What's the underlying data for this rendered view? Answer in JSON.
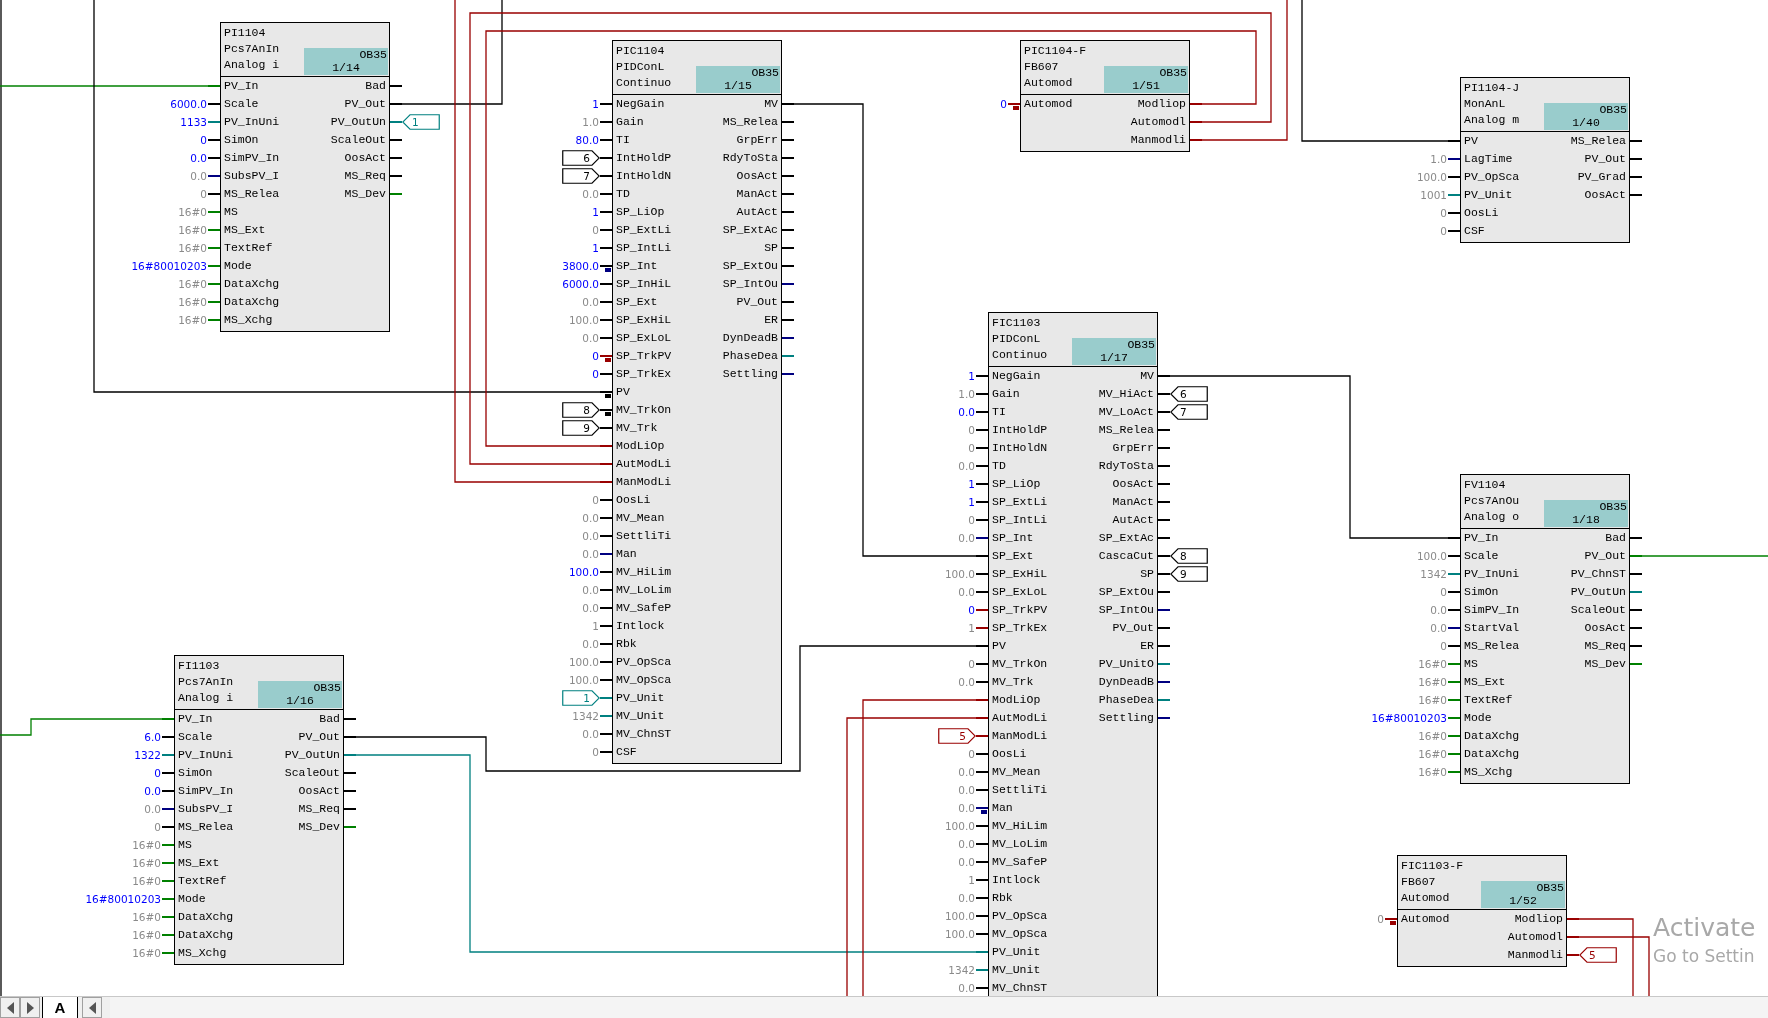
{
  "blocks": [
    {
      "name": "PI1104",
      "type": "Pcs7AnIn",
      "comment": "Analog i",
      "task": "OB35",
      "order": "1/14",
      "inputs": [
        {
          "pin": "PV_In",
          "kind": "wire",
          "color": "#008000"
        },
        {
          "pin": "Scale",
          "kind": "value",
          "value": "6000.0",
          "user_set": true
        },
        {
          "pin": "PV_InUni",
          "kind": "value",
          "value": "1133",
          "user_set": true,
          "color": "#008080"
        },
        {
          "pin": "SimOn",
          "kind": "value",
          "value": "0",
          "user_set": true
        },
        {
          "pin": "SimPV_In",
          "kind": "value",
          "value": "0.0",
          "user_set": true
        },
        {
          "pin": "SubsPV_I",
          "kind": "value",
          "value": "0.0",
          "user_set": false,
          "color": "#000080"
        },
        {
          "pin": "MS_Relea",
          "kind": "value",
          "value": "0",
          "user_set": false
        },
        {
          "pin": "MS",
          "kind": "value",
          "value": "16#0",
          "user_set": false,
          "color": "#008000"
        },
        {
          "pin": "MS_Ext",
          "kind": "value",
          "value": "16#0",
          "user_set": false,
          "color": "#008000"
        },
        {
          "pin": "TextRef",
          "kind": "value",
          "value": "16#0",
          "user_set": false,
          "color": "#008000"
        },
        {
          "pin": "Mode",
          "kind": "value",
          "value": "16#80010203",
          "user_set": true,
          "color": "#008000"
        },
        {
          "pin": "DataXchg",
          "kind": "value",
          "value": "16#0",
          "user_set": false,
          "color": "#008000"
        },
        {
          "pin": "DataXchg",
          "kind": "value",
          "value": "16#0",
          "user_set": false,
          "color": "#008000"
        },
        {
          "pin": "MS_Xchg",
          "kind": "value",
          "value": "16#0",
          "user_set": false,
          "color": "#008000"
        }
      ],
      "outputs": [
        {
          "pin": "Bad",
          "kind": "stub"
        },
        {
          "pin": "PV_Out",
          "kind": "stub"
        },
        {
          "pin": "PV_OutUn",
          "kind": "connector",
          "value": "1",
          "color": "#008080"
        },
        {
          "pin": "ScaleOut",
          "kind": "stub"
        },
        {
          "pin": "OosAct",
          "kind": "stub"
        },
        {
          "pin": "MS_Req",
          "kind": "stub"
        },
        {
          "pin": "MS_Dev",
          "kind": "stub",
          "color": "#008000"
        }
      ]
    },
    {
      "name": "PIC1104",
      "type": "PIDConL",
      "comment": "Continuo",
      "task": "OB35",
      "order": "1/15",
      "inputs": [
        {
          "pin": "NegGain",
          "kind": "value",
          "value": "1",
          "user_set": true
        },
        {
          "pin": "Gain",
          "kind": "value",
          "value": "1.0",
          "user_set": false
        },
        {
          "pin": "TI",
          "kind": "value",
          "value": "80.0",
          "user_set": true
        },
        {
          "pin": "IntHoldP",
          "kind": "connector",
          "value": "6"
        },
        {
          "pin": "IntHoldN",
          "kind": "connector",
          "value": "7"
        },
        {
          "pin": "TD",
          "kind": "value",
          "value": "0.0",
          "user_set": false
        },
        {
          "pin": "SP_LiOp",
          "kind": "value",
          "value": "1",
          "user_set": true
        },
        {
          "pin": "SP_ExtLi",
          "kind": "value",
          "value": "0",
          "user_set": false
        },
        {
          "pin": "SP_IntLi",
          "kind": "value",
          "value": "1",
          "user_set": true
        },
        {
          "pin": "SP_Int",
          "kind": "value",
          "value": "3800.0",
          "user_set": true,
          "marker": {
            "color": "#000080"
          }
        },
        {
          "pin": "SP_InHiL",
          "kind": "value",
          "value": "6000.0",
          "user_set": true
        },
        {
          "pin": "SP_Ext",
          "kind": "value",
          "value": "0.0",
          "user_set": false
        },
        {
          "pin": "SP_ExHiL",
          "kind": "value",
          "value": "100.0",
          "user_set": false
        },
        {
          "pin": "SP_ExLoL",
          "kind": "value",
          "value": "0.0",
          "user_set": false
        },
        {
          "pin": "SP_TrkPV",
          "kind": "value",
          "value": "0",
          "user_set": true,
          "color": "#990000",
          "marker": {
            "color": "#990000"
          }
        },
        {
          "pin": "SP_TrkEx",
          "kind": "value",
          "value": "0",
          "user_set": true
        },
        {
          "pin": "PV",
          "kind": "wire",
          "marker": {
            "color": "#000000"
          }
        },
        {
          "pin": "MV_TrkOn",
          "kind": "connector",
          "value": "8",
          "marker": {
            "color": "#000000"
          }
        },
        {
          "pin": "MV_Trk",
          "kind": "connector",
          "value": "9"
        },
        {
          "pin": "ModLiOp",
          "kind": "wire",
          "color": "#990000"
        },
        {
          "pin": "AutModLi",
          "kind": "wire",
          "color": "#990000"
        },
        {
          "pin": "ManModLi",
          "kind": "wire",
          "color": "#990000"
        },
        {
          "pin": "OosLi",
          "kind": "value",
          "value": "0",
          "user_set": false
        },
        {
          "pin": "MV_Mean",
          "kind": "value",
          "value": "0.0",
          "user_set": false
        },
        {
          "pin": "SettliTi",
          "kind": "value",
          "value": "0.0",
          "user_set": false
        },
        {
          "pin": "Man",
          "kind": "value",
          "value": "0.0",
          "user_set": false,
          "color": "#000080"
        },
        {
          "pin": "MV_HiLim",
          "kind": "value",
          "value": "100.0",
          "user_set": true
        },
        {
          "pin": "MV_LoLim",
          "kind": "value",
          "value": "0.0",
          "user_set": false
        },
        {
          "pin": "MV_SafeP",
          "kind": "value",
          "value": "0.0",
          "user_set": false
        },
        {
          "pin": "Intlock",
          "kind": "value",
          "value": "1",
          "user_set": false
        },
        {
          "pin": "Rbk",
          "kind": "value",
          "value": "0.0",
          "user_set": false
        },
        {
          "pin": "PV_OpSca",
          "kind": "value",
          "value": "100.0",
          "user_set": false
        },
        {
          "pin": "MV_OpSca",
          "kind": "value",
          "value": "100.0",
          "user_set": false
        },
        {
          "pin": "PV_Unit",
          "kind": "connector",
          "value": "1",
          "color": "#008080"
        },
        {
          "pin": "MV_Unit",
          "kind": "value",
          "value": "1342",
          "user_set": false,
          "color": "#008080"
        },
        {
          "pin": "MV_ChnST",
          "kind": "value",
          "value": "0.0",
          "user_set": false
        },
        {
          "pin": "CSF",
          "kind": "value",
          "value": "0",
          "user_set": false
        }
      ],
      "outputs": [
        {
          "pin": "MV",
          "kind": "stub"
        },
        {
          "pin": "MS_Relea",
          "kind": "stub"
        },
        {
          "pin": "GrpErr",
          "kind": "stub"
        },
        {
          "pin": "RdyToSta",
          "kind": "stub"
        },
        {
          "pin": "OosAct",
          "kind": "stub"
        },
        {
          "pin": "ManAct",
          "kind": "stub"
        },
        {
          "pin": "AutAct",
          "kind": "stub"
        },
        {
          "pin": "SP_ExtAc",
          "kind": "stub"
        },
        {
          "pin": "SP",
          "kind": "stub"
        },
        {
          "pin": "SP_ExtOu",
          "kind": "stub"
        },
        {
          "pin": "SP_IntOu",
          "kind": "stub",
          "color": "#000080"
        },
        {
          "pin": "PV_Out",
          "kind": "stub"
        },
        {
          "pin": "ER",
          "kind": "stub"
        },
        {
          "pin": "DynDeadB",
          "kind": "stub",
          "color": "#000080"
        },
        {
          "pin": "PhaseDea",
          "kind": "stub",
          "color": "#008080"
        },
        {
          "pin": "Settling",
          "kind": "stub",
          "color": "#000080"
        }
      ]
    },
    {
      "name": "PIC1104-F",
      "type": "FB607",
      "comment": "Automod",
      "task": "OB35",
      "order": "1/51",
      "inputs": [
        {
          "pin": "Automod",
          "kind": "value",
          "value": "0",
          "user_set": true,
          "color": "#990000",
          "marker": {
            "color": "#990000"
          }
        }
      ],
      "outputs": [
        {
          "pin": "Modliop",
          "kind": "stub",
          "color": "#990000"
        },
        {
          "pin": "Automodl",
          "kind": "stub",
          "color": "#990000"
        },
        {
          "pin": "Manmodli",
          "kind": "stub",
          "color": "#990000"
        }
      ]
    },
    {
      "name": "PI1104-J",
      "type": "MonAnL",
      "comment": "Analog m",
      "task": "OB35",
      "order": "1/40",
      "inputs": [
        {
          "pin": "PV",
          "kind": "wire"
        },
        {
          "pin": "LagTime",
          "kind": "value",
          "value": "1.0",
          "user_set": false,
          "color": "#000080"
        },
        {
          "pin": "PV_OpSca",
          "kind": "value",
          "value": "100.0",
          "user_set": false
        },
        {
          "pin": "PV_Unit",
          "kind": "value",
          "value": "1001",
          "user_set": false,
          "color": "#008080"
        },
        {
          "pin": "OosLi",
          "kind": "value",
          "value": "0",
          "user_set": false
        },
        {
          "pin": "CSF",
          "kind": "value",
          "value": "0",
          "user_set": false
        }
      ],
      "outputs": [
        {
          "pin": "MS_Relea",
          "kind": "stub"
        },
        {
          "pin": "PV_Out",
          "kind": "stub"
        },
        {
          "pin": "PV_Grad",
          "kind": "stub"
        },
        {
          "pin": "OosAct",
          "kind": "stub"
        }
      ]
    },
    {
      "name": "FIC1103",
      "type": "PIDConL",
      "comment": "Continuo",
      "task": "OB35",
      "order": "1/17",
      "inputs": [
        {
          "pin": "NegGain",
          "kind": "value",
          "value": "1",
          "user_set": true
        },
        {
          "pin": "Gain",
          "kind": "value",
          "value": "1.0",
          "user_set": false
        },
        {
          "pin": "TI",
          "kind": "value",
          "value": "0.0",
          "user_set": true
        },
        {
          "pin": "IntHoldP",
          "kind": "value",
          "value": "0",
          "user_set": false
        },
        {
          "pin": "IntHoldN",
          "kind": "value",
          "value": "0",
          "user_set": false
        },
        {
          "pin": "TD",
          "kind": "value",
          "value": "0.0",
          "user_set": false
        },
        {
          "pin": "SP_LiOp",
          "kind": "value",
          "value": "1",
          "user_set": true
        },
        {
          "pin": "SP_ExtLi",
          "kind": "value",
          "value": "1",
          "user_set": true
        },
        {
          "pin": "SP_IntLi",
          "kind": "value",
          "value": "0",
          "user_set": false
        },
        {
          "pin": "SP_Int",
          "kind": "value",
          "value": "0.0",
          "user_set": false,
          "color": "#000080"
        },
        {
          "pin": "SP_Ext",
          "kind": "wire"
        },
        {
          "pin": "SP_ExHiL",
          "kind": "value",
          "value": "100.0",
          "user_set": false
        },
        {
          "pin": "SP_ExLoL",
          "kind": "value",
          "value": "0.0",
          "user_set": false
        },
        {
          "pin": "SP_TrkPV",
          "kind": "value",
          "value": "0",
          "user_set": true,
          "color": "#990000"
        },
        {
          "pin": "SP_TrkEx",
          "kind": "value",
          "value": "1",
          "user_set": false,
          "color": "#990000"
        },
        {
          "pin": "PV",
          "kind": "wire"
        },
        {
          "pin": "MV_TrkOn",
          "kind": "value",
          "value": "0",
          "user_set": false
        },
        {
          "pin": "MV_Trk",
          "kind": "value",
          "value": "0.0",
          "user_set": false
        },
        {
          "pin": "ModLiOp",
          "kind": "wire",
          "color": "#990000"
        },
        {
          "pin": "AutModLi",
          "kind": "wire",
          "color": "#990000"
        },
        {
          "pin": "ManModLi",
          "kind": "connector",
          "value": "5",
          "color": "#990000"
        },
        {
          "pin": "OosLi",
          "kind": "value",
          "value": "0",
          "user_set": false
        },
        {
          "pin": "MV_Mean",
          "kind": "value",
          "value": "0.0",
          "user_set": false
        },
        {
          "pin": "SettliTi",
          "kind": "value",
          "value": "0.0",
          "user_set": false
        },
        {
          "pin": "Man",
          "kind": "value",
          "value": "0.0",
          "user_set": false,
          "color": "#000080",
          "marker": {
            "color": "#000080"
          }
        },
        {
          "pin": "MV_HiLim",
          "kind": "value",
          "value": "100.0",
          "user_set": false
        },
        {
          "pin": "MV_LoLim",
          "kind": "value",
          "value": "0.0",
          "user_set": false
        },
        {
          "pin": "MV_SafeP",
          "kind": "value",
          "value": "0.0",
          "user_set": false
        },
        {
          "pin": "Intlock",
          "kind": "value",
          "value": "1",
          "user_set": false
        },
        {
          "pin": "Rbk",
          "kind": "value",
          "value": "0.0",
          "user_set": false
        },
        {
          "pin": "PV_OpSca",
          "kind": "value",
          "value": "100.0",
          "user_set": false
        },
        {
          "pin": "MV_OpSca",
          "kind": "value",
          "value": "100.0",
          "user_set": false
        },
        {
          "pin": "PV_Unit",
          "kind": "wire",
          "color": "#008080"
        },
        {
          "pin": "MV_Unit",
          "kind": "value",
          "value": "1342",
          "user_set": false,
          "color": "#008080"
        },
        {
          "pin": "MV_ChnST",
          "kind": "value",
          "value": "0.0",
          "user_set": false
        }
      ],
      "outputs": [
        {
          "pin": "MV",
          "kind": "stub"
        },
        {
          "pin": "MV_HiAct",
          "kind": "connector",
          "value": "6"
        },
        {
          "pin": "MV_LoAct",
          "kind": "connector",
          "value": "7"
        },
        {
          "pin": "MS_Relea",
          "kind": "stub"
        },
        {
          "pin": "GrpErr",
          "kind": "stub"
        },
        {
          "pin": "RdyToSta",
          "kind": "stub"
        },
        {
          "pin": "OosAct",
          "kind": "stub"
        },
        {
          "pin": "ManAct",
          "kind": "stub"
        },
        {
          "pin": "AutAct",
          "kind": "stub"
        },
        {
          "pin": "SP_ExtAc",
          "kind": "stub"
        },
        {
          "pin": "CascaCut",
          "kind": "connector",
          "value": "8"
        },
        {
          "pin": "SP",
          "kind": "connector",
          "value": "9"
        },
        {
          "pin": "SP_ExtOu",
          "kind": "stub"
        },
        {
          "pin": "SP_IntOu",
          "kind": "stub",
          "color": "#000080"
        },
        {
          "pin": "PV_Out",
          "kind": "stub"
        },
        {
          "pin": "ER",
          "kind": "stub"
        },
        {
          "pin": "PV_UnitO",
          "kind": "stub",
          "color": "#008080"
        },
        {
          "pin": "DynDeadB",
          "kind": "stub",
          "color": "#000080"
        },
        {
          "pin": "PhaseDea",
          "kind": "stub",
          "color": "#008080"
        },
        {
          "pin": "Settling",
          "kind": "stub",
          "color": "#000080"
        }
      ]
    },
    {
      "name": "FV1104",
      "type": "Pcs7AnOu",
      "comment": "Analog o",
      "task": "OB35",
      "order": "1/18",
      "inputs": [
        {
          "pin": "PV_In",
          "kind": "wire"
        },
        {
          "pin": "Scale",
          "kind": "value",
          "value": "100.0",
          "user_set": false
        },
        {
          "pin": "PV_InUni",
          "kind": "value",
          "value": "1342",
          "user_set": false,
          "color": "#008080"
        },
        {
          "pin": "SimOn",
          "kind": "value",
          "value": "0",
          "user_set": false
        },
        {
          "pin": "SimPV_In",
          "kind": "value",
          "value": "0.0",
          "user_set": false
        },
        {
          "pin": "StartVal",
          "kind": "value",
          "value": "0.0",
          "user_set": false,
          "color": "#000080"
        },
        {
          "pin": "MS_Relea",
          "kind": "value",
          "value": "0",
          "user_set": false
        },
        {
          "pin": "MS",
          "kind": "value",
          "value": "16#0",
          "user_set": false,
          "color": "#008000"
        },
        {
          "pin": "MS_Ext",
          "kind": "value",
          "value": "16#0",
          "user_set": false,
          "color": "#008000"
        },
        {
          "pin": "TextRef",
          "kind": "value",
          "value": "16#0",
          "user_set": false,
          "color": "#008000"
        },
        {
          "pin": "Mode",
          "kind": "value",
          "value": "16#80010203",
          "user_set": true,
          "color": "#008000"
        },
        {
          "pin": "DataXchg",
          "kind": "value",
          "value": "16#0",
          "user_set": false,
          "color": "#008000"
        },
        {
          "pin": "DataXchg",
          "kind": "value",
          "value": "16#0",
          "user_set": false,
          "color": "#008000"
        },
        {
          "pin": "MS_Xchg",
          "kind": "value",
          "value": "16#0",
          "user_set": false,
          "color": "#008000"
        }
      ],
      "outputs": [
        {
          "pin": "Bad",
          "kind": "stub"
        },
        {
          "pin": "PV_Out",
          "kind": "stub",
          "color": "#008000"
        },
        {
          "pin": "PV_ChnST",
          "kind": "stub"
        },
        {
          "pin": "PV_OutUn",
          "kind": "stub",
          "color": "#008080"
        },
        {
          "pin": "ScaleOut",
          "kind": "stub"
        },
        {
          "pin": "OosAct",
          "kind": "stub"
        },
        {
          "pin": "MS_Req",
          "kind": "stub"
        },
        {
          "pin": "MS_Dev",
          "kind": "stub",
          "color": "#008000"
        }
      ]
    },
    {
      "name": "FI1103",
      "type": "Pcs7AnIn",
      "comment": "Analog i",
      "task": "OB35",
      "order": "1/16",
      "inputs": [
        {
          "pin": "PV_In",
          "kind": "wire",
          "color": "#008000"
        },
        {
          "pin": "Scale",
          "kind": "value",
          "value": "6.0",
          "user_set": true
        },
        {
          "pin": "PV_InUni",
          "kind": "value",
          "value": "1322",
          "user_set": true,
          "color": "#008080"
        },
        {
          "pin": "SimOn",
          "kind": "value",
          "value": "0",
          "user_set": true
        },
        {
          "pin": "SimPV_In",
          "kind": "value",
          "value": "0.0",
          "user_set": true
        },
        {
          "pin": "SubsPV_I",
          "kind": "value",
          "value": "0.0",
          "user_set": false,
          "color": "#000080"
        },
        {
          "pin": "MS_Relea",
          "kind": "value",
          "value": "0",
          "user_set": false
        },
        {
          "pin": "MS",
          "kind": "value",
          "value": "16#0",
          "user_set": false,
          "color": "#008000"
        },
        {
          "pin": "MS_Ext",
          "kind": "value",
          "value": "16#0",
          "user_set": false,
          "color": "#008000"
        },
        {
          "pin": "TextRef",
          "kind": "value",
          "value": "16#0",
          "user_set": false,
          "color": "#008000"
        },
        {
          "pin": "Mode",
          "kind": "value",
          "value": "16#80010203",
          "user_set": true,
          "color": "#008000"
        },
        {
          "pin": "DataXchg",
          "kind": "value",
          "value": "16#0",
          "user_set": false,
          "color": "#008000"
        },
        {
          "pin": "DataXchg",
          "kind": "value",
          "value": "16#0",
          "user_set": false,
          "color": "#008000"
        },
        {
          "pin": "MS_Xchg",
          "kind": "value",
          "value": "16#0",
          "user_set": false,
          "color": "#008000"
        }
      ],
      "outputs": [
        {
          "pin": "Bad",
          "kind": "stub"
        },
        {
          "pin": "PV_Out",
          "kind": "stub"
        },
        {
          "pin": "PV_OutUn",
          "kind": "stub",
          "color": "#008080"
        },
        {
          "pin": "ScaleOut",
          "kind": "stub"
        },
        {
          "pin": "OosAct",
          "kind": "stub"
        },
        {
          "pin": "MS_Req",
          "kind": "stub"
        },
        {
          "pin": "MS_Dev",
          "kind": "stub",
          "color": "#008000"
        }
      ]
    },
    {
      "name": "FIC1103-F",
      "type": "FB607",
      "comment": "Automod",
      "task": "OB35",
      "order": "1/52",
      "inputs": [
        {
          "pin": "Automod",
          "kind": "value",
          "value": "0",
          "user_set": false,
          "color": "#990000",
          "marker": {
            "color": "#990000"
          }
        }
      ],
      "outputs": [
        {
          "pin": "Modliop",
          "kind": "stub",
          "color": "#990000"
        },
        {
          "pin": "Automodl",
          "kind": "stub",
          "color": "#990000"
        },
        {
          "pin": "Manmodli",
          "kind": "connector",
          "value": "5",
          "color": "#990000"
        }
      ]
    }
  ],
  "sheet_tabs": [
    {
      "label": "A",
      "selected": true
    }
  ],
  "activation_notice": {
    "title": "Activate",
    "subtitle": "Go to Settin"
  }
}
